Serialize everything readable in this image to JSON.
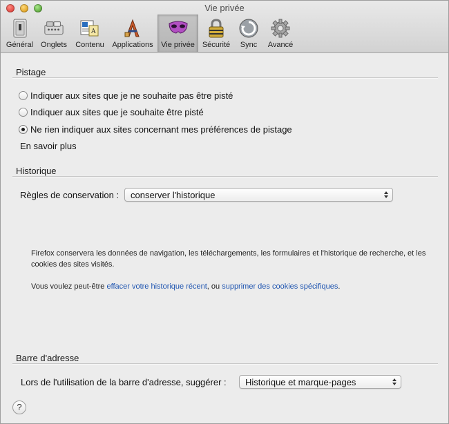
{
  "window": {
    "title": "Vie privée"
  },
  "toolbar": {
    "items": [
      {
        "label": "Général",
        "icon": "switch-icon"
      },
      {
        "label": "Onglets",
        "icon": "tabs-icon"
      },
      {
        "label": "Contenu",
        "icon": "content-icon"
      },
      {
        "label": "Applications",
        "icon": "applications-icon"
      },
      {
        "label": "Vie privée",
        "icon": "mask-icon",
        "selected": true
      },
      {
        "label": "Sécurité",
        "icon": "padlock-icon"
      },
      {
        "label": "Sync",
        "icon": "sync-icon"
      },
      {
        "label": "Avancé",
        "icon": "gear-icon"
      }
    ]
  },
  "tracking": {
    "title": "Pistage",
    "options": [
      "Indiquer aux sites que je ne souhaite pas être pisté",
      "Indiquer aux sites que je souhaite être pisté",
      "Ne rien indiquer aux sites concernant mes préférences de pistage"
    ],
    "selected_index": 2,
    "learn_more": "En savoir plus"
  },
  "history": {
    "title": "Historique",
    "rules_label": "Règles de conservation :",
    "rules_value": "conserver l'historique",
    "description": "Firefox conservera les données de navigation, les téléchargements, les formulaires et l'historique de recherche, et les cookies des sites visités.",
    "maybe_prefix": "Vous voulez peut-être ",
    "clear_link": "effacer votre historique récent",
    "maybe_middle": ", ou ",
    "cookies_link": "supprimer des cookies spécifiques",
    "maybe_suffix": "."
  },
  "urlbar": {
    "title": "Barre d'adresse",
    "suggest_label": "Lors de l'utilisation de la barre d'adresse, suggérer :",
    "suggest_value": "Historique et marque-pages"
  },
  "help": {
    "glyph": "?"
  },
  "colors": {
    "link": "#1f55b0",
    "selected_tab": "#b9b9b9"
  }
}
